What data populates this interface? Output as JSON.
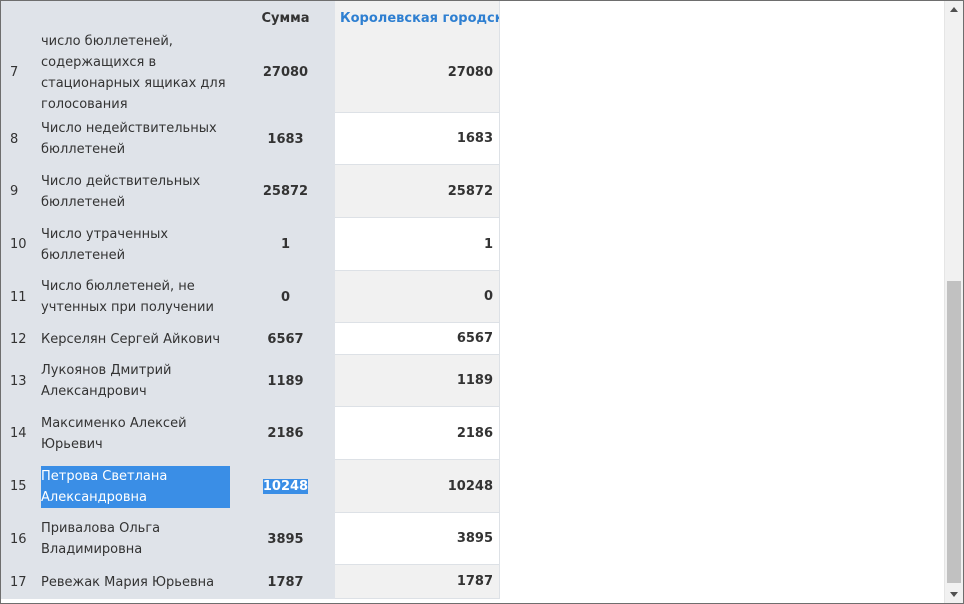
{
  "table": {
    "header": {
      "num": "",
      "name": "",
      "sum": "Сумма",
      "territory": "Королевская городская"
    },
    "rows": [
      {
        "num": "7",
        "name": "число бюллетеней, содержащихся в стационарных ящиках для голосования",
        "sum": "27080",
        "value": "27080"
      },
      {
        "num": "8",
        "name": "Число недействительных бюллетеней",
        "sum": "1683",
        "value": "1683"
      },
      {
        "num": "9",
        "name": "Число действительных бюллетеней",
        "sum": "25872",
        "value": "25872"
      },
      {
        "num": "10",
        "name": "Число утраченных бюллетеней",
        "sum": "1",
        "value": "1"
      },
      {
        "num": "11",
        "name": "Число бюллетеней, не учтенных при получении",
        "sum": "0",
        "value": "0"
      },
      {
        "num": "12",
        "name": "Керселян Сергей Айкович",
        "sum": "6567",
        "value": "6567"
      },
      {
        "num": "13",
        "name": "Лукоянов Дмитрий Александрович",
        "sum": "1189",
        "value": "1189"
      },
      {
        "num": "14",
        "name": "Максименко Алексей Юрьевич",
        "sum": "2186",
        "value": "2186"
      },
      {
        "num": "15",
        "name": "Петрова Светлана Александровна",
        "sum": "10248",
        "value": "10248",
        "selected": true
      },
      {
        "num": "16",
        "name": "Привалова Ольга Владимировна",
        "sum": "3895",
        "value": "3895"
      },
      {
        "num": "17",
        "name": "Ревежак Мария Юрьевна",
        "sum": "1787",
        "value": "1787"
      }
    ]
  },
  "scrollbar": {
    "up_icon": "chevron-up-icon",
    "down_icon": "chevron-down-icon",
    "position_fraction": 1.0
  },
  "colors": {
    "label_column_bg": "#dfe3e9",
    "header_link": "#2e7fd1",
    "selection": "#3a8ee6"
  }
}
